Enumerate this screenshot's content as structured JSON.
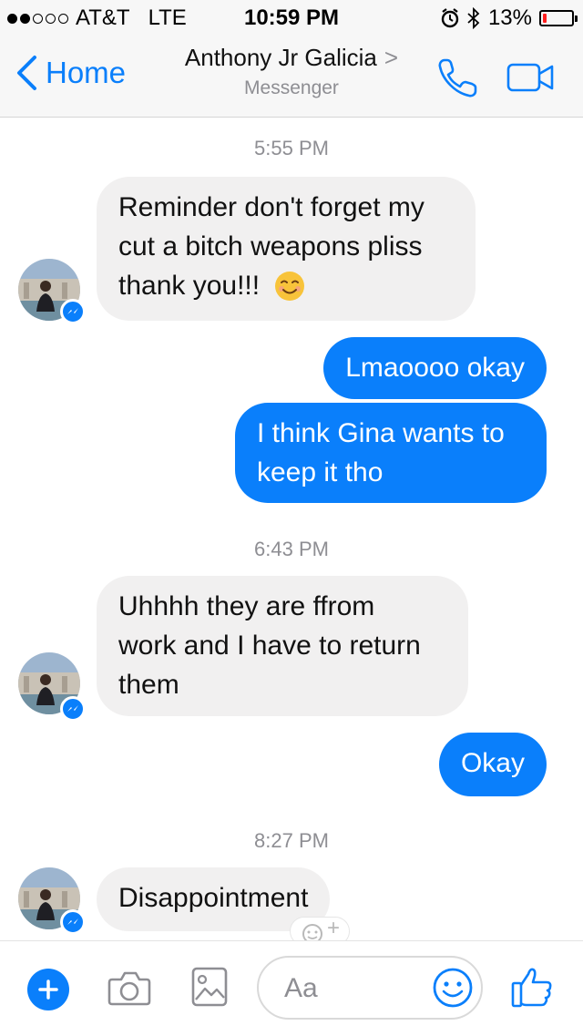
{
  "status_bar": {
    "carrier": "AT&T",
    "network": "LTE",
    "time": "10:59 PM",
    "battery": "13%",
    "battery_level": 0.13,
    "signal_bars_filled": 2,
    "signal_bars_total": 5
  },
  "header": {
    "back_label": "Home",
    "contact_name": "Anthony Jr Galicia",
    "subtitle": "Messenger",
    "chevron": ">"
  },
  "messages": [
    {
      "type": "timestamp",
      "text": "5:55 PM"
    },
    {
      "type": "incoming",
      "lines": [
        "Reminder don't forget my",
        "cut a bitch weapons pliss",
        "thank you!!!"
      ],
      "emoji": "smiling-face"
    },
    {
      "type": "outgoing",
      "lines": [
        "Lmaoooo okay"
      ]
    },
    {
      "type": "outgoing",
      "lines": [
        "I think Gina wants to",
        "keep it tho"
      ]
    },
    {
      "type": "timestamp",
      "text": "6:43 PM"
    },
    {
      "type": "incoming",
      "lines": [
        "Uhhhh they are ffrom",
        "work and I have to return",
        "them"
      ]
    },
    {
      "type": "outgoing",
      "lines": [
        "Okay"
      ]
    },
    {
      "type": "timestamp",
      "text": "8:27 PM"
    },
    {
      "type": "incoming",
      "lines": [
        "Disappointment"
      ]
    }
  ],
  "composer": {
    "placeholder": "Aa",
    "react_plus": "+"
  },
  "colors": {
    "accent": "#0a7ffb",
    "incoming_bubble": "#f1f0f0",
    "header_bg": "#f7f7f7",
    "battery_low": "#ff1f1f"
  },
  "icons": [
    "chevron-left-icon",
    "phone-icon",
    "video-camera-icon",
    "messenger-icon",
    "plus-icon",
    "camera-icon",
    "gallery-icon",
    "emoji-icon",
    "thumbs-up-icon",
    "add-reaction-icon",
    "alarm-icon",
    "bluetooth-icon"
  ]
}
